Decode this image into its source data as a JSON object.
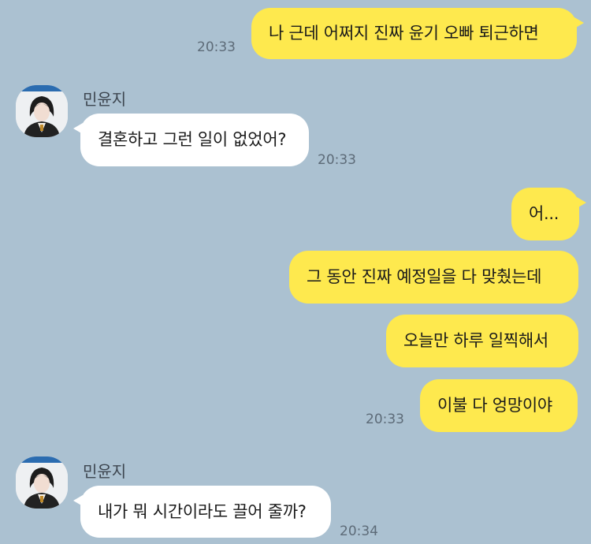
{
  "messages": [
    {
      "side": "mine",
      "text": "나 근데 어쩌지 진짜 윤기 오빠 퇴근하면",
      "time": "20:33"
    },
    {
      "side": "theirs",
      "sender": "민윤지",
      "text": "결혼하고 그런 일이 없었어?",
      "time": "20:33"
    },
    {
      "side": "mine",
      "text": "어..."
    },
    {
      "side": "mine",
      "text": "그 동안 진짜 예정일을 다 맞췄는데"
    },
    {
      "side": "mine",
      "text": "오늘만 하루 일찍해서"
    },
    {
      "side": "mine",
      "text": "이불 다 엉망이야",
      "time": "20:33"
    },
    {
      "side": "theirs",
      "sender": "민윤지",
      "text": "내가 뭐 시간이라도 끌어 줄까?",
      "time": "20:34"
    }
  ],
  "colors": {
    "background": "#abc1d1",
    "mine_bubble": "#fee94e",
    "theirs_bubble": "#ffffff"
  }
}
